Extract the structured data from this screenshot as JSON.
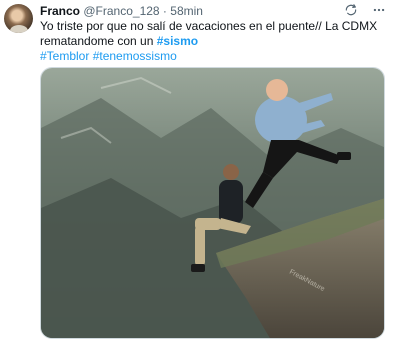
{
  "tweet": {
    "author_name": "Franco",
    "handle": "@Franco_128",
    "separator": " · ",
    "time": "58min",
    "text_line1": "Yo triste por que no salí de vacaciones en el puente// La CDMX",
    "text_line2_prefix": "rematandome con un ",
    "text_line2_hashtag": "#sismo",
    "hashtag_1": "#Temblor",
    "hashtag_2": "#tenemossismo"
  },
  "media": {
    "watermark": "FreakNature"
  },
  "icons": {
    "avatar": "profile-avatar",
    "grok": "grok-icon",
    "more": "more-horizontal-icon"
  },
  "colors": {
    "accent": "#1d9bf0",
    "text": "#0f1419",
    "secondary": "#536471"
  }
}
